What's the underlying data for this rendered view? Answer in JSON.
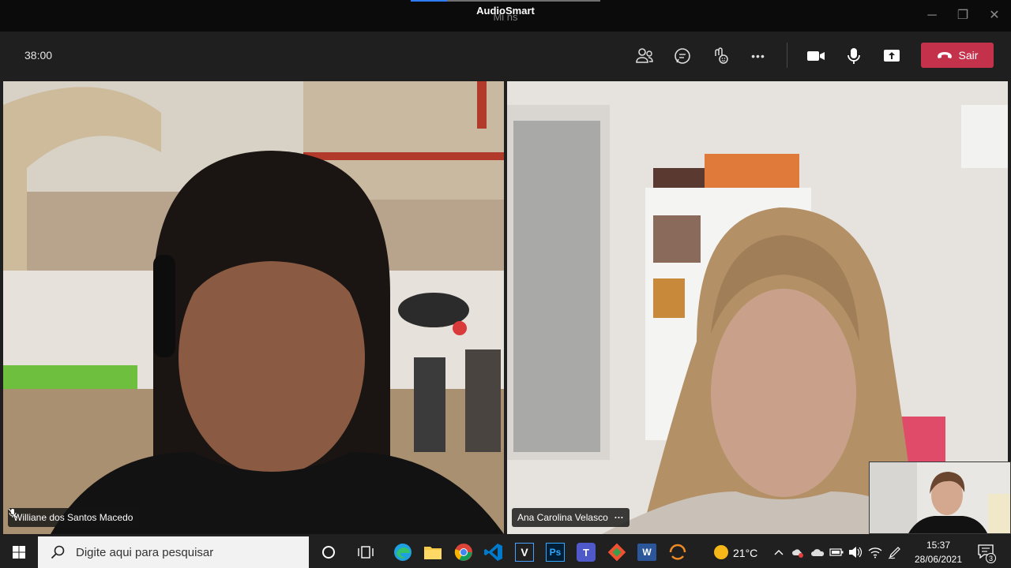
{
  "window": {
    "overlay_label": "AudioSmart",
    "title_partial": "Mi              ns",
    "controls": {
      "minimize": "─",
      "restore": "❐",
      "close": "✕"
    }
  },
  "toolbar": {
    "timer": "38:00",
    "icons": [
      "participants-icon",
      "chat-icon",
      "reactions-icon",
      "more-options-icon",
      "camera-icon",
      "microphone-icon",
      "share-screen-icon"
    ],
    "more_label": "•••",
    "leave_label": "Sair",
    "leave_color": "#c4314b"
  },
  "participants": [
    {
      "name": "Williane dos Santos Macedo",
      "muted": true
    },
    {
      "name": "Ana Carolina Velasco",
      "menu": "···"
    }
  ],
  "taskbar": {
    "search_placeholder": "Digite aqui para pesquisar",
    "apps": [
      "task-view-icon",
      "edge-icon",
      "file-explorer-icon",
      "chrome-icon",
      "vscode-icon",
      "v-app-icon",
      "photoshop-icon",
      "teams-icon",
      "git-icon",
      "word-icon",
      "orange-app-icon"
    ],
    "weather": "21°C",
    "time": "15:37",
    "date": "28/06/2021",
    "notifications": "3",
    "ps_label": "Ps",
    "v_label": "V",
    "w_label": "W",
    "t_label": "T"
  }
}
